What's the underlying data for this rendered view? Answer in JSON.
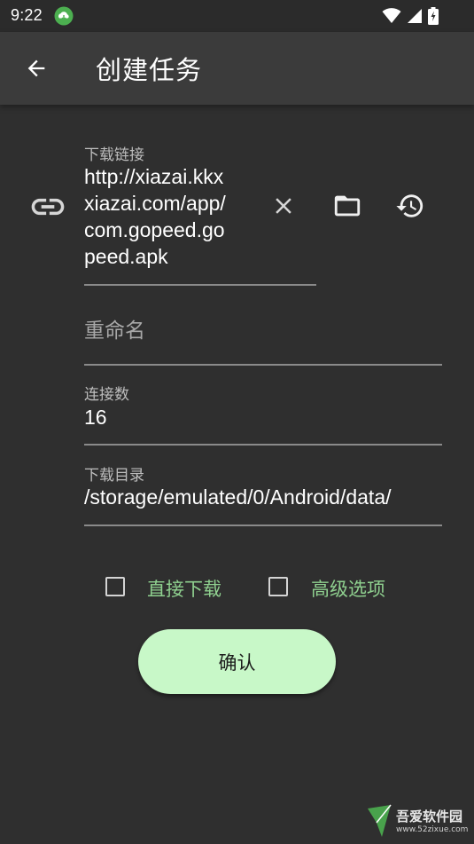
{
  "status_bar": {
    "time": "9:22",
    "app_icon": "cloud-download-icon",
    "icons": [
      "wifi-icon",
      "cellular-signal-icon",
      "battery-charging-icon"
    ]
  },
  "app_bar": {
    "back_icon": "arrow-back-icon",
    "title": "创建任务"
  },
  "form": {
    "url": {
      "label": "下载链接",
      "value": "http://xiazai.kkxxiazai.com/app/com.gopeed.gopeed.apk",
      "lines": [
        "http://xiazai.kkx",
        "xiazai.com/app/",
        "com.gopeed.go",
        "peed.apk"
      ],
      "leading_icon": "link-icon",
      "actions": [
        "clear-icon",
        "folder-icon",
        "history-icon"
      ]
    },
    "rename": {
      "placeholder": "重命名",
      "value": ""
    },
    "connections": {
      "label": "连接数",
      "value": "16"
    },
    "directory": {
      "label": "下载目录",
      "value": "/storage/emulated/0/Android/data/"
    }
  },
  "options": {
    "direct_download": {
      "label": "直接下载",
      "checked": false
    },
    "advanced": {
      "label": "高级选项",
      "checked": false
    }
  },
  "confirm_label": "确认",
  "colors": {
    "background": "#2f2f2f",
    "app_bar": "#3b3b3b",
    "accent_green": "#8fd08f",
    "button_fill": "#c8f8c8"
  },
  "watermark": {
    "text": "吾爱软件园",
    "url": "www.52zixue.com"
  }
}
